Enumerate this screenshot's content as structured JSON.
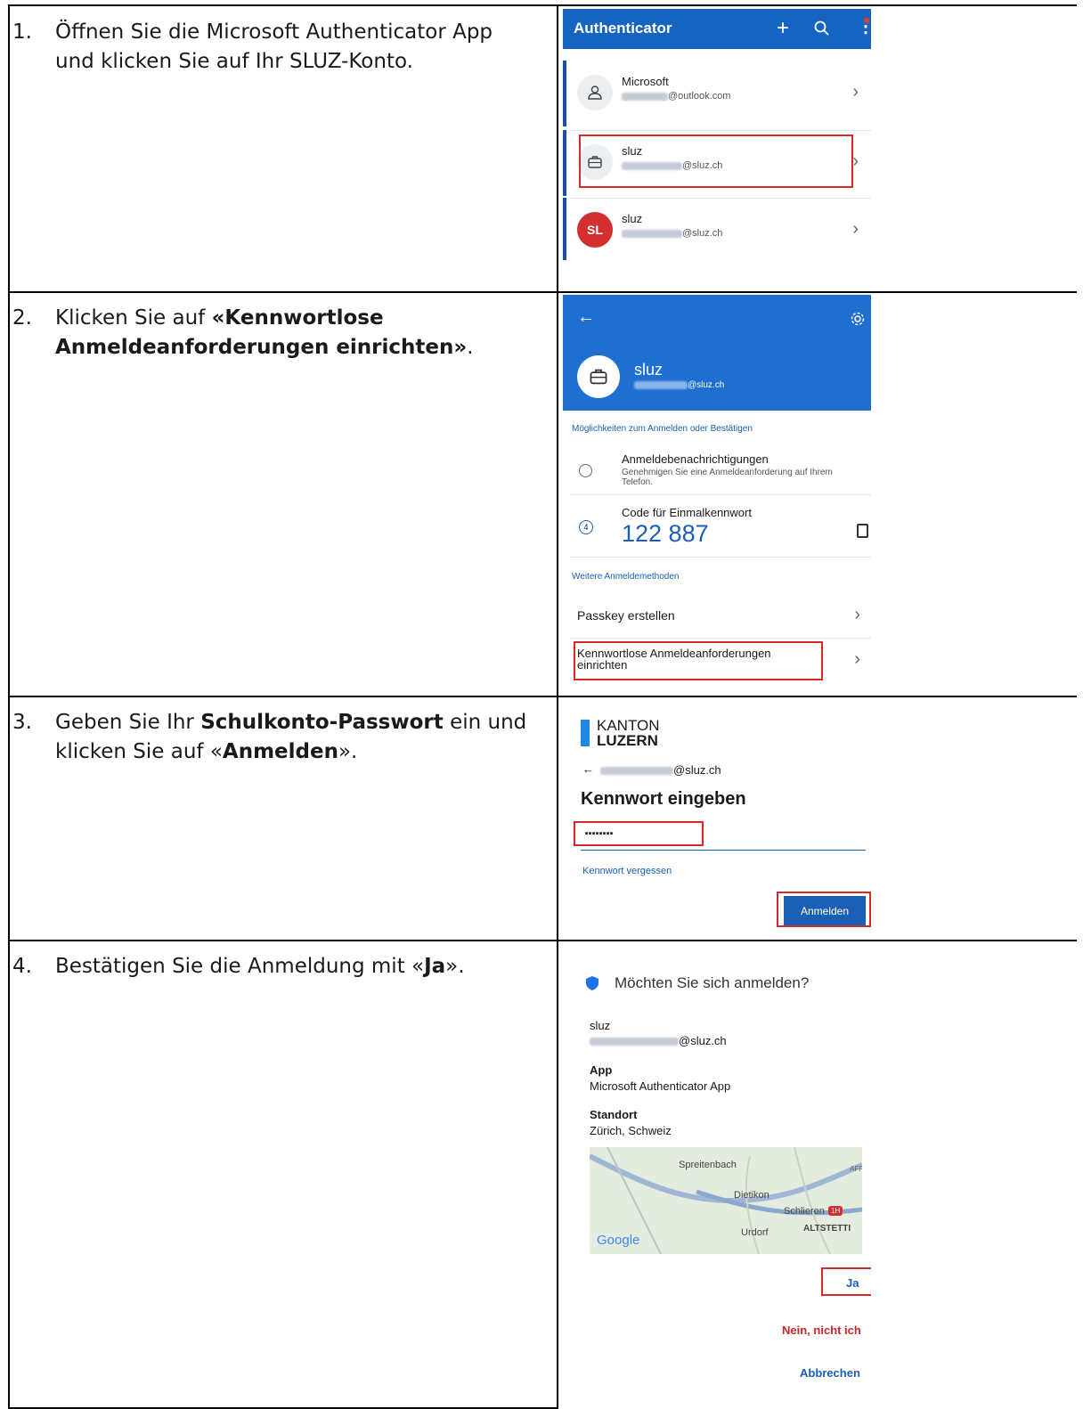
{
  "steps": [
    {
      "num": "1.",
      "text": "Öffnen Sie die Microsoft Authenticator App und klicken Sie auf Ihr SLUZ-Konto."
    },
    {
      "num": "2.",
      "pre": "Klicken Sie auf ",
      "bold": "«Kennwortlose Anmeldeanforderungen einrichten»",
      "post": "."
    },
    {
      "num": "3.",
      "pre": "Geben Sie Ihr ",
      "bold": "Schulkonto-Passwort",
      "mid": " ein und klicken Sie auf «",
      "bold2": "Anmelden",
      "post": "»."
    },
    {
      "num": "4.",
      "pre": "Bestätigen Sie die Anmeldung mit «",
      "bold": "Ja",
      "post": "»."
    }
  ],
  "shot1": {
    "title": "Authenticator",
    "accounts": [
      {
        "name": "Microsoft",
        "email_suffix": "@outlook.com",
        "avatar": "person-icon"
      },
      {
        "name": "sluz",
        "email_suffix": "@sluz.ch",
        "avatar": "briefcase-icon"
      },
      {
        "name": "sluz",
        "email_suffix": "@sluz.ch",
        "avatar_text": "SL",
        "avatar_color": "#d32f2f"
      }
    ]
  },
  "shot2": {
    "account_name": "sluz",
    "account_email": "@sluz.ch",
    "section1": "Möglichkeiten zum Anmelden oder Bestätigen",
    "notif_title": "Anmeldebenachrichtigungen",
    "notif_desc": "Genehmigen Sie eine Anmeldeanforderung auf Ihrem Telefon.",
    "otp_title": "Code für Einmalkennwort",
    "otp_code": "122 887",
    "otp_timer": "4",
    "section2": "Weitere Anmeldemethoden",
    "passkey": "Passkey erstellen",
    "passwordless": "Kennwortlose Anmeldeanforderungen einrichten"
  },
  "shot3": {
    "brand_top": "KANTON",
    "brand_bottom": "LUZERN",
    "email_suffix": "@sluz.ch",
    "heading": "Kennwort eingeben",
    "password_mask": "········",
    "forgot": "Kennwort vergessen",
    "signin": "Anmelden",
    "brand_color": "#1e88e5"
  },
  "shot4": {
    "question": "Möchten Sie sich anmelden?",
    "account": "sluz",
    "email_suffix": "@sluz.ch",
    "app_label": "App",
    "app_value": "Microsoft Authenticator App",
    "loc_label": "Standort",
    "loc_value": "Zürich, Schweiz",
    "map_places": [
      "Spreitenbach",
      "Dietikon",
      "Schlieren",
      "Urdorf",
      "ALTSTETTI",
      "AFF"
    ],
    "map_badge": "1H",
    "map_brand": "Google",
    "yes": "Ja",
    "no": "Nein, nicht ich",
    "cancel": "Abbrechen"
  }
}
